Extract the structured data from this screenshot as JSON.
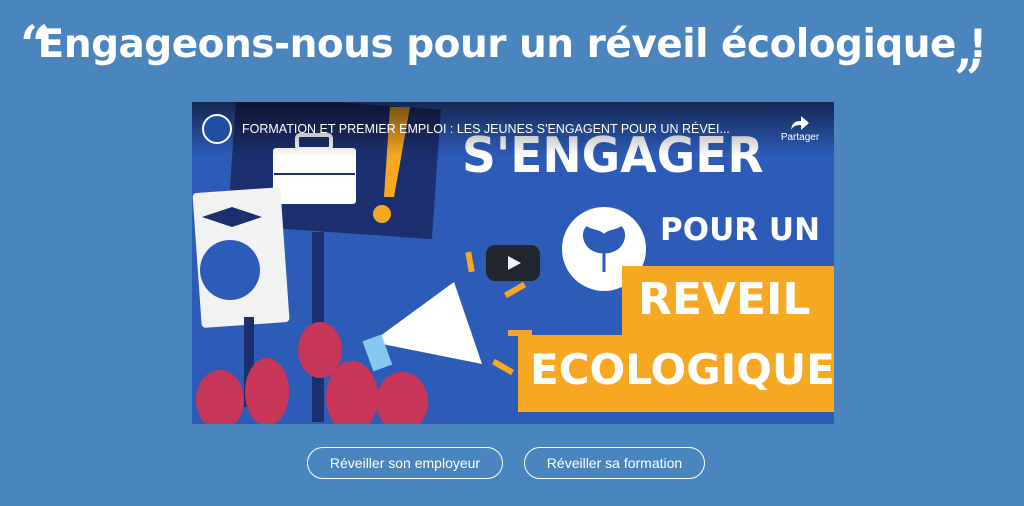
{
  "headline": {
    "open_quote": "“",
    "text": "Engageons-nous pour un réveil écologique !",
    "close_quote": "”"
  },
  "video": {
    "title": "FORMATION ET PREMIER EMPLOI : LES JEUNES S'ENGAGENT POUR UN RÉVEI...",
    "share_label": "Partager",
    "thumbnail": {
      "line1": "S'ENGAGER",
      "line2": "POUR UN",
      "line3": "REVEIL",
      "line4": "ECOLOGIQUE"
    },
    "play_icon": "play-icon",
    "colors": {
      "background": "#2d5bb8",
      "accent": "#f7a823"
    }
  },
  "buttons": {
    "employer": "Réveiller son employeur",
    "training": "Réveiller sa formation"
  },
  "colors": {
    "page_background": "#4a86bd",
    "text": "#ffffff"
  }
}
